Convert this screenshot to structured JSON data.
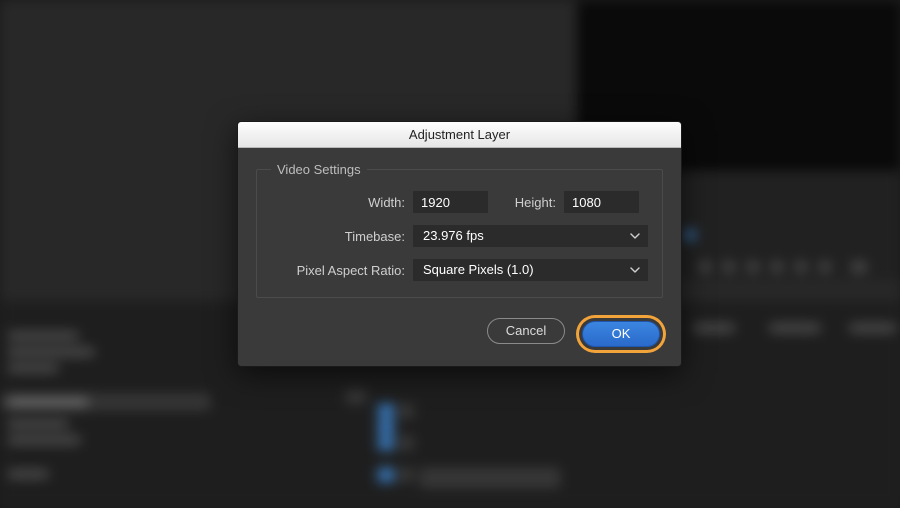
{
  "dialog": {
    "title": "Adjustment Layer",
    "group_label": "Video Settings",
    "width_label": "Width:",
    "width_value": "1920",
    "height_label": "Height:",
    "height_value": "1080",
    "timebase_label": "Timebase:",
    "timebase_value": "23.976 fps",
    "par_label": "Pixel Aspect Ratio:",
    "par_value": "Square Pixels (1.0)",
    "cancel_label": "Cancel",
    "ok_label": "OK"
  }
}
